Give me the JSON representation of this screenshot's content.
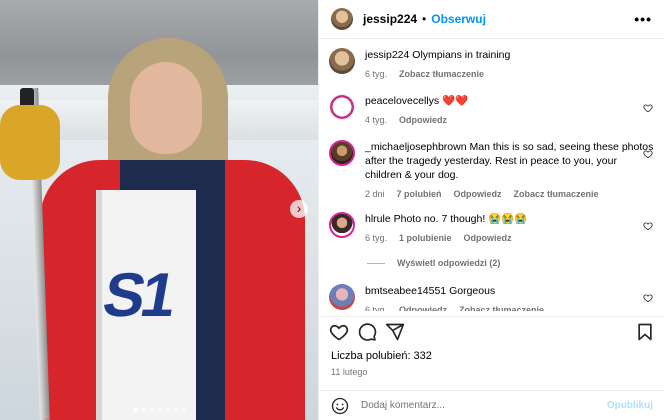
{
  "post": {
    "author": "jessip224",
    "separator": "•",
    "follow_label": "Obserwuj",
    "more_label": "•••"
  },
  "photo": {
    "jersey_number": "S1",
    "next_arrow": "›",
    "slide_count": 7,
    "active_slide": 1
  },
  "caption": {
    "user": "jessip224",
    "text": "Olympians in training",
    "time": "6 tyg.",
    "translate": "Zobacz tłumaczenie"
  },
  "comments": [
    {
      "user": "peacelovecellys",
      "text": "❤️❤️",
      "time": "4 tyg.",
      "reply": "Odpowiedz"
    },
    {
      "user": "_michaeljosephbrown",
      "text": "Man this is so sad, seeing these photos after the tragedy yesterday. Rest in peace to you, your children & your dog.",
      "time": "2 dni",
      "likes": "7 polubień",
      "reply": "Odpowiedz",
      "translate": "Zobacz tłumaczenie"
    },
    {
      "user": "hlrule",
      "text": "Photo no. 7 though! 😭😭😭",
      "time": "6 tyg.",
      "likes": "1 polubienie",
      "reply": "Odpowiedz"
    },
    {
      "user": "bmtseabee14551",
      "text": "Gorgeous",
      "time": "6 tyg.",
      "reply": "Odpowiedz",
      "translate": "Zobacz tłumaczenie"
    }
  ],
  "view_replies": "Wyświetl odpowiedzi (2)",
  "stats": {
    "likes": "Liczba polubień: 332",
    "date": "11 lutego"
  },
  "composer": {
    "placeholder": "Dodaj komentarz...",
    "publish": "Opublikuj"
  },
  "icons": {
    "more": "more-options-icon",
    "heart": "heart-icon",
    "comment": "comment-icon",
    "share": "share-icon",
    "bookmark": "bookmark-icon",
    "emoji": "emoji-icon",
    "next": "chevron-right-icon"
  },
  "colors": {
    "link_blue": "#0095f6",
    "muted": "#737373",
    "publish_disabled": "#b2dffc"
  }
}
